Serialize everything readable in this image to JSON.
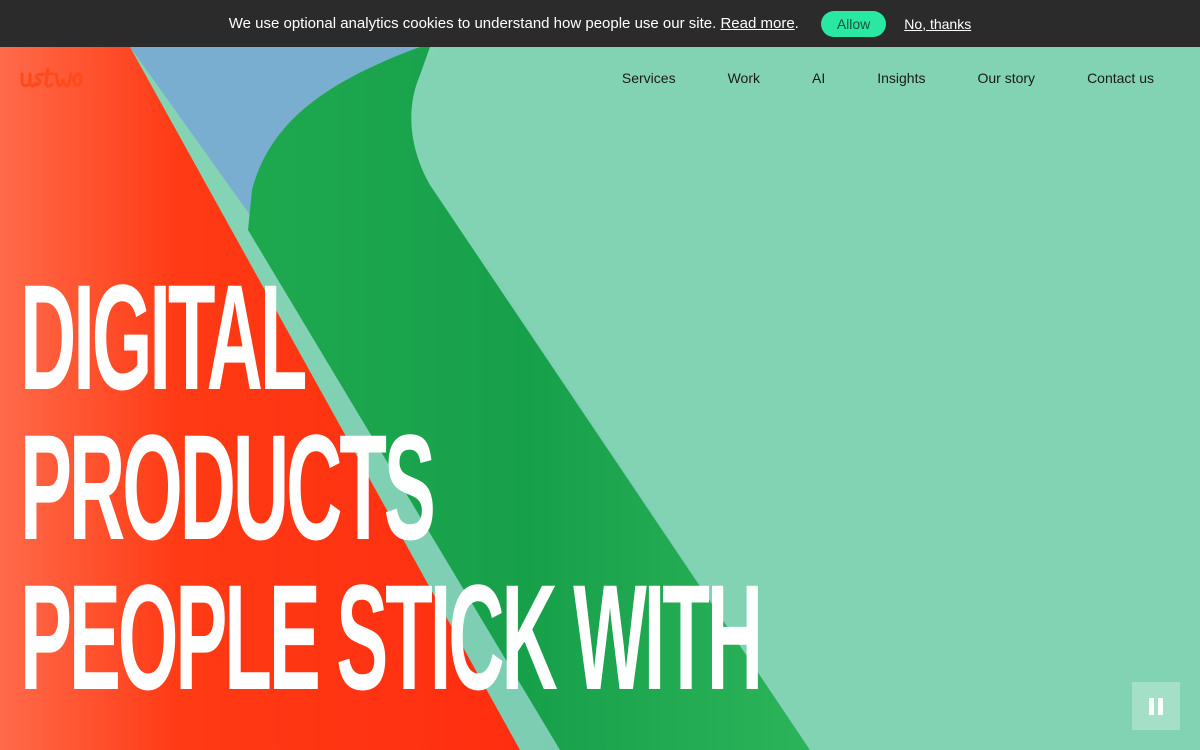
{
  "cookie_banner": {
    "message": "We use optional analytics cookies to understand how people use our site.",
    "read_more_label": "Read more",
    "trailing_period": ".",
    "allow_label": "Allow",
    "decline_label": "No, thanks"
  },
  "header": {
    "logo_text": "ustwo",
    "nav": [
      {
        "label": "Services"
      },
      {
        "label": "Work"
      },
      {
        "label": "AI"
      },
      {
        "label": "Insights"
      },
      {
        "label": "Our story"
      },
      {
        "label": "Contact us"
      }
    ]
  },
  "hero": {
    "headline_lines": [
      "DIGITAL",
      "PRODUCTS",
      "PEOPLE STICK WITH"
    ],
    "pause_control": "pause-icon"
  },
  "colors": {
    "cookie_bar": "#2b2b2b",
    "allow_button": "#29e8a1",
    "mint": "#7ecdb0",
    "green": "#22a84e",
    "red": "#ff3a1c",
    "blue": "#7aaed0",
    "logo": "#ff4a1c"
  }
}
